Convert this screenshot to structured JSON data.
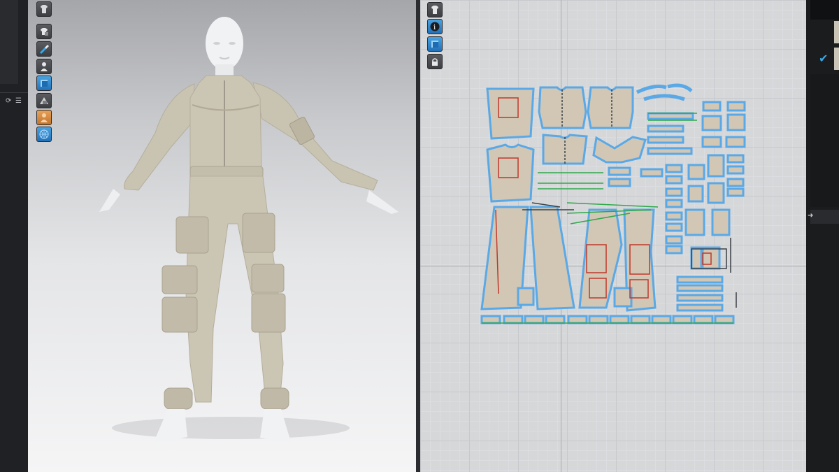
{
  "left_strip": {
    "refresh_symbol": "⟳",
    "list_symbol": "☰"
  },
  "viewport3d": {
    "toolbar": [
      {
        "icon": "garment-icon"
      },
      {
        "icon": "shirt-fold-icon"
      },
      {
        "icon": "brush-icon"
      },
      {
        "icon": "avatar-icon"
      },
      {
        "icon": "blue-layer-icon",
        "active": true
      },
      {
        "icon": "gray-layer-icon"
      },
      {
        "icon": "person-icon"
      },
      {
        "icon": "globe-icon"
      }
    ],
    "garment_color": "#c8c2b1",
    "avatar_color": "#f2f3f5"
  },
  "pattern_view": {
    "toolbar": [
      {
        "icon": "shirt-icon"
      },
      {
        "icon": "info-icon",
        "active": true
      },
      {
        "icon": "blue-square-icon",
        "active": true
      },
      {
        "icon": "lock-icon"
      }
    ],
    "piece_fill": "#d2c7b5",
    "outline_color": "#5aa9e6",
    "seam_color": "#2fa84a",
    "notch_color": "#c0392b"
  },
  "right_panel": {
    "check_symbol": "✔",
    "arrow_symbol": "➜"
  }
}
